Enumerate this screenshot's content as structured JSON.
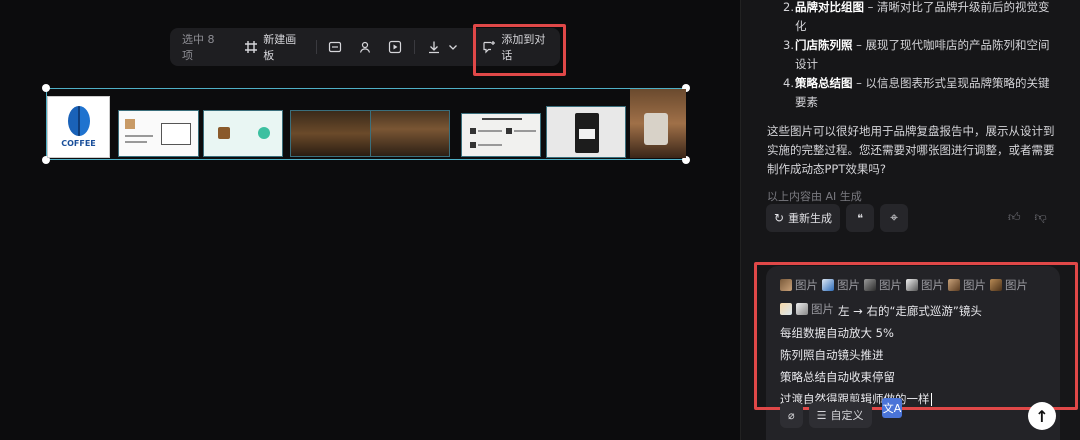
{
  "toolbar": {
    "selected_count": "选中 8 项",
    "new_board_label": "新建画板",
    "add_to_chat_label": "添加到对话"
  },
  "canvas": {
    "logo_text": "COFFEE"
  },
  "message": {
    "list": [
      {
        "num": "2.",
        "title": "品牌对比组图",
        "desc": " – 清晰对比了品牌升级前后的视觉变化"
      },
      {
        "num": "3.",
        "title": "门店陈列照",
        "desc": " – 展现了现代咖啡店的产品陈列和空间设计"
      },
      {
        "num": "4.",
        "title": "策略总结图",
        "desc": " – 以信息图表形式呈现品牌策略的关键要素"
      }
    ],
    "paragraph": "这些图片可以很好地用于品牌复盘报告中，展示从设计到实施的完整过程。您还需要对哪张图进行调整，或者需要制作成动态PPT效果吗?",
    "ai_note": "以上内容由 AI 生成"
  },
  "actions": {
    "regenerate_label": "重新生成",
    "quote_symbol": "❝",
    "target_symbol": "⌖"
  },
  "input": {
    "chip_label": "图片",
    "line1_suffix": "左 → 右的“走廊式巡游”镜头",
    "line2": "每组数据自动放大 5%",
    "line3": "陈列照自动镜头推进",
    "line4": "策略总结自动收束停留",
    "line5": "过渡自然得跟剪辑师做的一样",
    "custom_label": "自定义",
    "translate_symbol": "文A"
  },
  "colors": {
    "highlight": "#e04848",
    "selection": "#4fb0c6",
    "panel_bg": "#161618"
  }
}
